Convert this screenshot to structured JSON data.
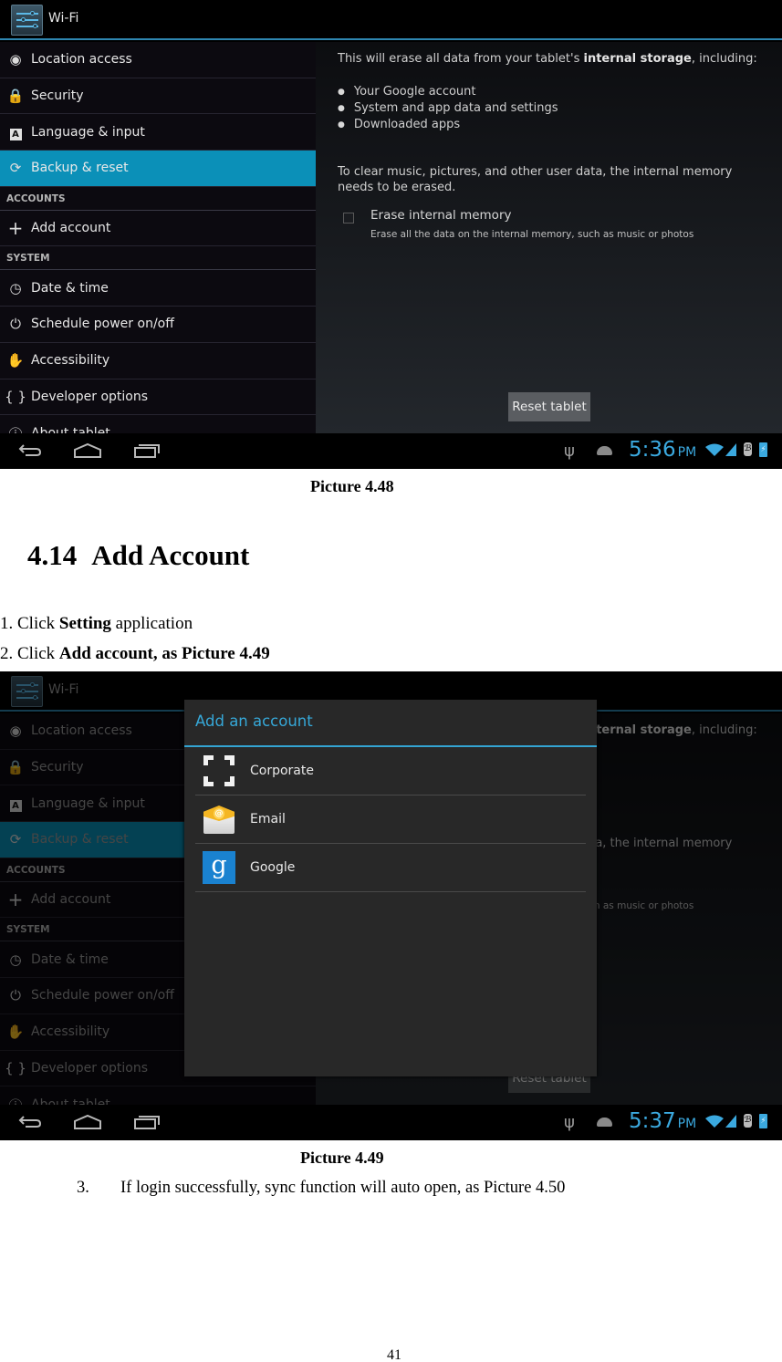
{
  "screenshot_1": {
    "actionbar_title": "Wi-Fi",
    "sidebar": {
      "items_top": [
        {
          "icon": "location-icon",
          "label": "Location access"
        },
        {
          "icon": "lock-icon",
          "label": "Security"
        },
        {
          "icon": "language-icon",
          "label": "Language & input"
        },
        {
          "icon": "backup-icon",
          "label": "Backup & reset",
          "active": true
        }
      ],
      "accounts_header": "ACCOUNTS",
      "accounts_items": [
        {
          "icon": "plus-icon",
          "label": "Add account"
        }
      ],
      "system_header": "SYSTEM",
      "system_items": [
        {
          "icon": "clock-icon",
          "label": "Date & time"
        },
        {
          "icon": "schedule-power-icon",
          "label": "Schedule power on/off"
        },
        {
          "icon": "hand-icon",
          "label": "Accessibility"
        },
        {
          "icon": "braces-icon",
          "label": "Developer options"
        },
        {
          "icon": "info-icon",
          "label": "About tablet"
        }
      ]
    },
    "content": {
      "intro_prefix": "This will erase all data from your tablet's ",
      "intro_bold": "internal storage",
      "intro_suffix": ", including:",
      "bullets": [
        "Your Google account",
        "System and app data and settings",
        "Downloaded apps"
      ],
      "clear_text": "To clear music, pictures, and other user data, the internal memory needs to be erased.",
      "checkbox_title": "Erase internal memory",
      "checkbox_subtitle": "Erase all the data on the internal memory, such as music or photos",
      "checkbox_checked": false,
      "reset_button": "Reset tablet"
    },
    "status_bar": {
      "time": "5:36",
      "ampm": "PM"
    }
  },
  "caption_1": "Picture 4.48",
  "section": {
    "number": "4.14",
    "title": "Add Account"
  },
  "steps": {
    "step1": {
      "prefix": "1. Click ",
      "bold": "Setting",
      "suffix": " application"
    },
    "step2": {
      "prefix": "2. Click ",
      "bold": "Add account, as Picture 4.49"
    }
  },
  "screenshot_2": {
    "actionbar_title": "Wi-Fi",
    "dialog": {
      "title": "Add an account",
      "accounts": [
        {
          "icon": "corporate-icon",
          "label": "Corporate"
        },
        {
          "icon": "email-icon",
          "label": "Email"
        },
        {
          "icon": "google-icon",
          "label": "Google"
        }
      ]
    },
    "status_bar": {
      "time": "5:37",
      "ampm": "PM"
    }
  },
  "caption_2": "Picture 4.49",
  "step3": {
    "number": "3.",
    "text": "If login successfully, sync function will auto open, as Picture 4.50"
  },
  "page_number": "41",
  "colors": {
    "accent": "#33b5e5",
    "active_item": "#0b90b8",
    "clock": "#3ba9df"
  }
}
